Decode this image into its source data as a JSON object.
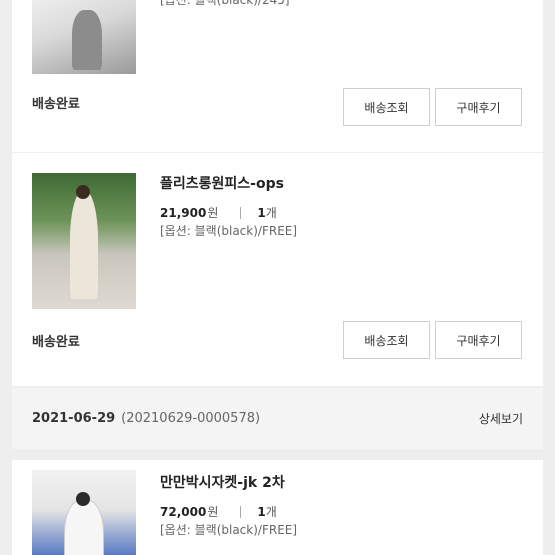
{
  "orders": [
    {
      "product_name": "",
      "price": "",
      "currency": "",
      "qty": "",
      "qty_unit": "",
      "option": "[옵션: 블랙(black)/245]",
      "status": "배송완료",
      "track_label": "배송조회",
      "review_label": "구매후기"
    },
    {
      "product_name": "플리츠롱원피스-ops",
      "price": "21,900",
      "currency": "원",
      "qty": "1",
      "qty_unit": "개",
      "option": "[옵션: 블랙(black)/FREE]",
      "status": "배송완료",
      "track_label": "배송조회",
      "review_label": "구매후기"
    },
    {
      "product_name": "만만박시자켓-jk 2차",
      "price": "72,000",
      "currency": "원",
      "qty": "1",
      "qty_unit": "개",
      "option": "[옵션: 블랙(black)/FREE]"
    }
  ],
  "order_group": {
    "date": "2021-06-29",
    "order_number": "(20210629-0000578)",
    "detail_label": "상세보기"
  },
  "icons": [
    "product-thumbnail"
  ],
  "colors": {
    "background": "#eeeeee",
    "card": "#ffffff",
    "header_bg": "#f4f4f4",
    "border": "#cfcfcf"
  }
}
